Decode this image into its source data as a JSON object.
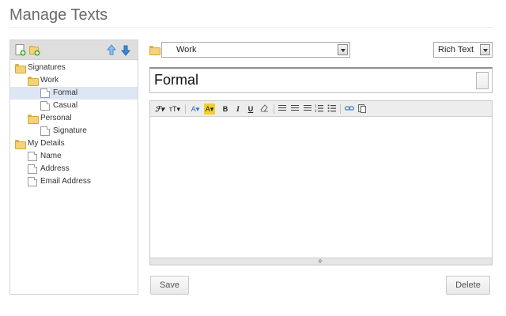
{
  "page": {
    "title": "Manage Texts"
  },
  "left_panel": {
    "toolbar_icons": [
      "add-text-icon",
      "add-folder-icon",
      "move-up-icon",
      "move-down-icon"
    ],
    "tree": [
      {
        "label": "Signatures",
        "type": "folder",
        "level": 0,
        "selected": false
      },
      {
        "label": "Work",
        "type": "folder",
        "level": 1,
        "selected": false
      },
      {
        "label": "Formal",
        "type": "document",
        "level": 2,
        "selected": true
      },
      {
        "label": "Casual",
        "type": "document",
        "level": 2,
        "selected": false
      },
      {
        "label": "Personal",
        "type": "folder",
        "level": 1,
        "selected": false
      },
      {
        "label": "Signature",
        "type": "document",
        "level": 2,
        "selected": false
      },
      {
        "label": "My Details",
        "type": "folder",
        "level": 0,
        "selected": false
      },
      {
        "label": "Name",
        "type": "document",
        "level": 1,
        "selected": false
      },
      {
        "label": "Address",
        "type": "document",
        "level": 1,
        "selected": false
      },
      {
        "label": "Email Address",
        "type": "document",
        "level": 1,
        "selected": false
      }
    ]
  },
  "editor": {
    "folder_select": {
      "value": "Work"
    },
    "format_select": {
      "value": "Rich Text"
    },
    "title_value": "Formal",
    "toolbar": {
      "font_family": "ℱ▾",
      "font_size": "ᴛT▾",
      "text_color": "A▾",
      "highlight_color": "A▾",
      "bold": "B",
      "italic": "I",
      "underline": "U"
    },
    "body": "",
    "colors": {
      "text_color": "#2b63c9",
      "highlight_color": "#f2d02a"
    }
  },
  "buttons": {
    "save": "Save",
    "delete": "Delete"
  }
}
